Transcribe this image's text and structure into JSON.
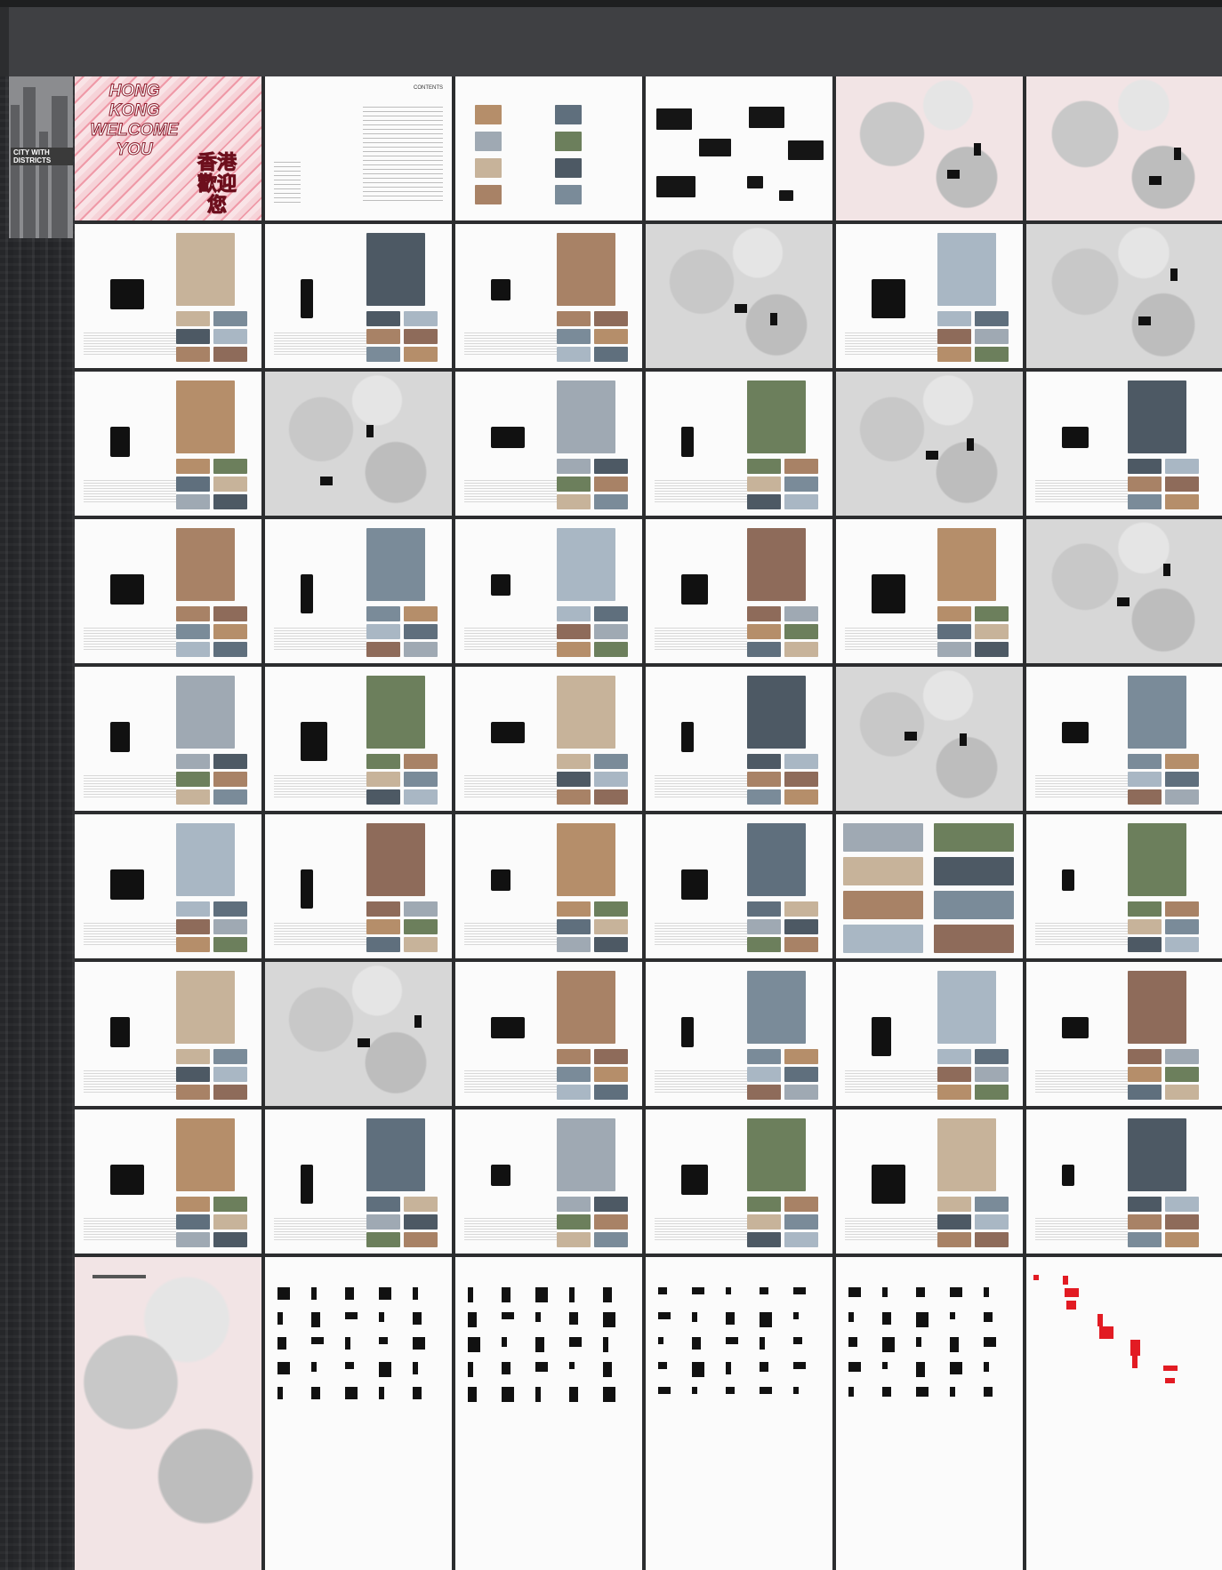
{
  "cover": {
    "title_en": "HONG KONG WELCOME YOU",
    "title_zh": "香港歡迎您",
    "left_tile_label": "CITY WITH DISTRICTS"
  },
  "contents": {
    "title": "CONTENTS"
  },
  "colors": {
    "background": "#2c2d2f",
    "header": "#3f4043",
    "page": "#fbfbfb",
    "cover_pink": "#f4c9cf",
    "accent_red": "#e21b23"
  }
}
